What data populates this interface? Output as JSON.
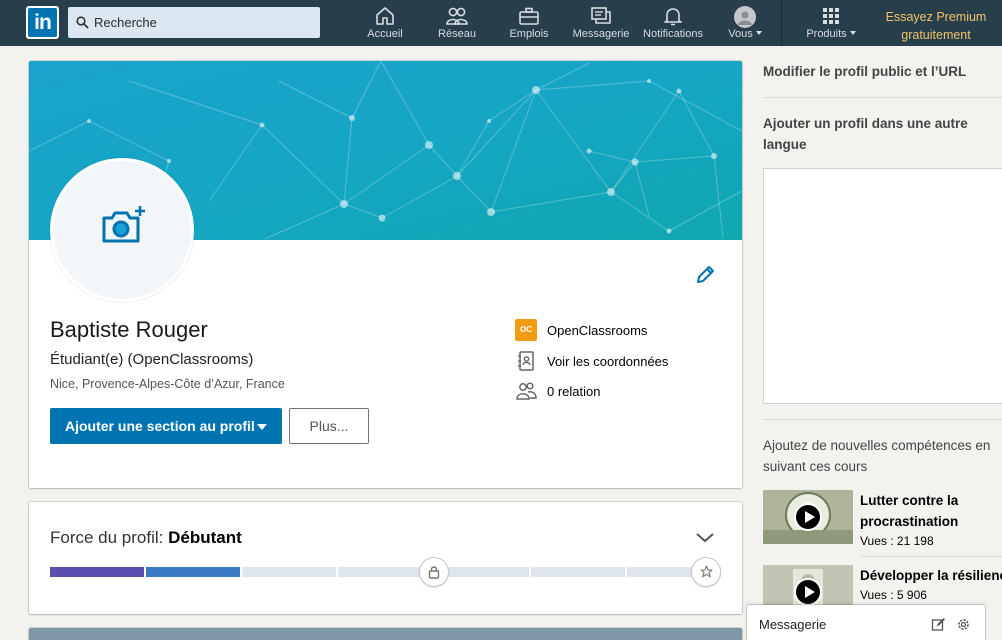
{
  "nav": {
    "logo_text": "in",
    "search_placeholder": "Recherche",
    "items": [
      {
        "label": "Accueil",
        "icon": "home-icon"
      },
      {
        "label": "Réseau",
        "icon": "network-icon"
      },
      {
        "label": "Emplois",
        "icon": "jobs-icon"
      },
      {
        "label": "Messagerie",
        "icon": "messaging-icon"
      },
      {
        "label": "Notifications",
        "icon": "bell-icon"
      },
      {
        "label": "Vous",
        "icon": "avatar-icon"
      },
      {
        "label": "Produits",
        "icon": "grid-icon"
      }
    ],
    "premium_line1": "Essayez Premium",
    "premium_line2": "gratuitement"
  },
  "profile": {
    "name": "Baptiste Rouger",
    "headline": "Étudiant(e) (OpenClassrooms)",
    "location": "Nice, Provence-Alpes-Côte d’Azur, France",
    "add_section_button": "Ajouter une section au profil",
    "more_button": "Plus...",
    "oc_logo_text": "OC",
    "side": {
      "school": "OpenClassrooms",
      "contact": "Voir les coordonnées",
      "connections": "0 relation"
    }
  },
  "strength": {
    "label": "Force du profil:",
    "level": "Débutant",
    "filled_segments": 2,
    "total_segments": 7
  },
  "rail": {
    "public_profile": "Modifier le profil public et l’URL",
    "other_language": "Ajouter un profil dans une autre langue",
    "skills_text": "Ajoutez de nouvelles compétences en suivant ces cours",
    "courses": [
      {
        "title": "Lutter contre la procrastination",
        "views": "Vues : 21 198"
      },
      {
        "title": "Développer la résilience",
        "views": "Vues : 5 906"
      }
    ]
  },
  "messaging": {
    "title": "Messagerie"
  },
  "colors": {
    "nav_bg": "#283e4a",
    "primary": "#0073b1",
    "premium": "#f2c26b",
    "meter_purple": "#5a4fb0",
    "meter_blue": "#3b78c3"
  }
}
